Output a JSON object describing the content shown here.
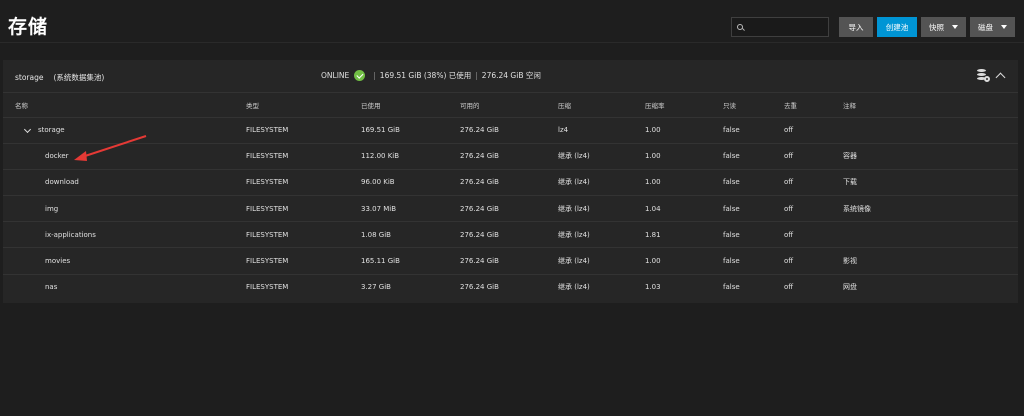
{
  "header": {
    "title": "存储",
    "search": {
      "placeholder": "",
      "value": ""
    },
    "buttons": {
      "import": "导入",
      "create_pool": "创建池",
      "snapshots": "快照",
      "disks": "磁盘"
    }
  },
  "pool": {
    "name": "storage",
    "description": "(系统数据集池)",
    "status": "ONLINE",
    "usage": "169.51 GiB (38%) 已使用",
    "free": "276.24 GiB 空闲",
    "separator": "|"
  },
  "table": {
    "columns": [
      "名称",
      "类型",
      "已使用",
      "可用的",
      "压缩",
      "压缩率",
      "只读",
      "去重",
      "注释"
    ],
    "rows": [
      {
        "name": "storage",
        "type": "FILESYSTEM",
        "used": "169.51 GiB",
        "available": "276.24 GiB",
        "compression": "lz4",
        "ratio": "1.00",
        "readonly": "false",
        "dedup": "off",
        "comment": ""
      },
      {
        "name": "docker",
        "type": "FILESYSTEM",
        "used": "112.00 KiB",
        "available": "276.24 GiB",
        "compression": "继承 (lz4)",
        "ratio": "1.00",
        "readonly": "false",
        "dedup": "off",
        "comment": "容器"
      },
      {
        "name": "download",
        "type": "FILESYSTEM",
        "used": "96.00 KiB",
        "available": "276.24 GiB",
        "compression": "继承 (lz4)",
        "ratio": "1.00",
        "readonly": "false",
        "dedup": "off",
        "comment": "下载"
      },
      {
        "name": "img",
        "type": "FILESYSTEM",
        "used": "33.07 MiB",
        "available": "276.24 GiB",
        "compression": "继承 (lz4)",
        "ratio": "1.04",
        "readonly": "false",
        "dedup": "off",
        "comment": "系统镜像"
      },
      {
        "name": "ix-applications",
        "type": "FILESYSTEM",
        "used": "1.08 GiB",
        "available": "276.24 GiB",
        "compression": "继承 (lz4)",
        "ratio": "1.81",
        "readonly": "false",
        "dedup": "off",
        "comment": ""
      },
      {
        "name": "movies",
        "type": "FILESYSTEM",
        "used": "165.11 GiB",
        "available": "276.24 GiB",
        "compression": "继承 (lz4)",
        "ratio": "1.00",
        "readonly": "false",
        "dedup": "off",
        "comment": "影视"
      },
      {
        "name": "nas",
        "type": "FILESYSTEM",
        "used": "3.27 GiB",
        "available": "276.24 GiB",
        "compression": "继承 (lz4)",
        "ratio": "1.03",
        "readonly": "false",
        "dedup": "off",
        "comment": "网盘"
      }
    ]
  },
  "colors": {
    "background": "#1e1e1e",
    "card": "#262626",
    "primary_button": "#0095d5",
    "secondary_button": "#545454",
    "status_ok": "#71bf44",
    "annotation_arrow": "#e53935"
  },
  "icons": {
    "search": "search-icon",
    "status": "check-circle-icon",
    "pool_settings": "database-gear-icon",
    "collapse_card": "chevron-up-icon",
    "expand_row": "chevron-down-icon",
    "row_menu": "more-vert-icon"
  }
}
